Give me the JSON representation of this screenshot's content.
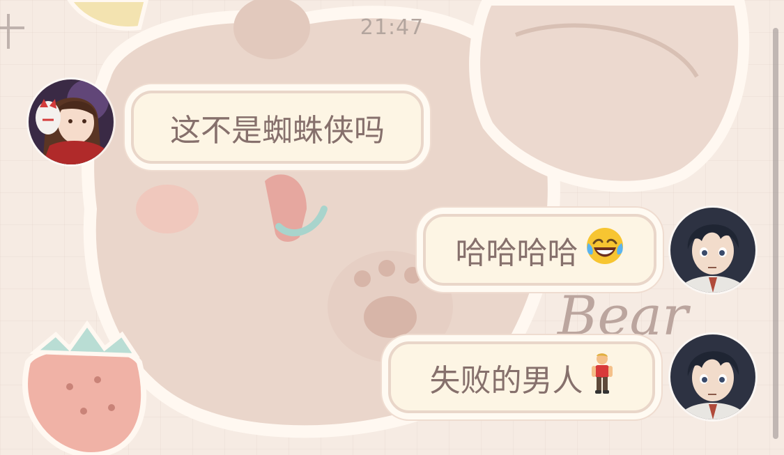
{
  "status": {
    "time": "21:47"
  },
  "background": {
    "watermark_text": "Bear"
  },
  "messages": [
    {
      "side": "left",
      "sender": "friend",
      "text": "这不是蜘蛛侠吗",
      "emoji": ""
    },
    {
      "side": "right",
      "sender": "me",
      "text": "哈哈哈哈",
      "emoji": "face-with-tears-of-joy-icon"
    },
    {
      "side": "right",
      "sender": "me",
      "text": "失败的男人",
      "emoji": "man-standing-icon"
    }
  ],
  "colors": {
    "bubble_fill": "#fdf5e4",
    "bubble_border": "#e9d6c9",
    "bubble_text": "#86706c",
    "timestamp": "#b3a59e"
  }
}
